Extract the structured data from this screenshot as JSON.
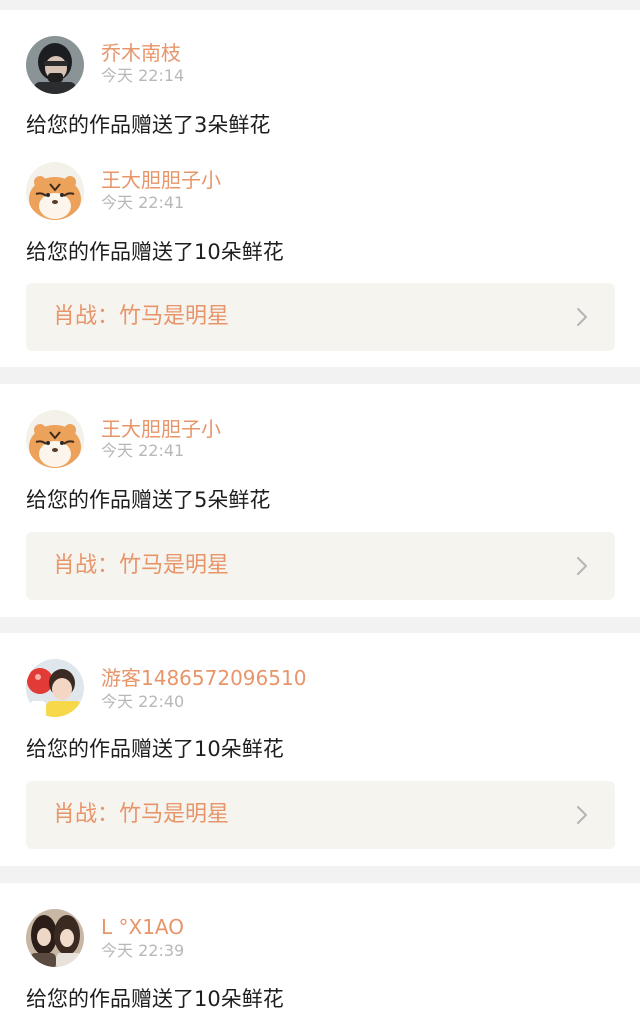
{
  "notifications": [
    {
      "user": "乔木南枝",
      "time": "今天 22:14",
      "message": "给您的作品赠送了3朵鲜花",
      "avatar": "avatar-dark-hair-photo"
    },
    {
      "user": "王大胆胆子小",
      "time": "今天 22:41",
      "message": "给您的作品赠送了10朵鲜花",
      "avatar": "avatar-tiger-illustration",
      "work_title": "肖战：竹马是明星"
    },
    {
      "user": "王大胆胆子小",
      "time": "今天 22:41",
      "message": "给您的作品赠送了5朵鲜花",
      "avatar": "avatar-tiger-illustration",
      "work_title": "肖战：竹马是明星"
    },
    {
      "user": "游客1486572096510",
      "time": "今天 22:40",
      "message": "给您的作品赠送了10朵鲜花",
      "avatar": "avatar-child-photo",
      "work_title": "肖战：竹马是明星"
    },
    {
      "user": "L °X1AO",
      "time": "今天 22:39",
      "message": "给您的作品赠送了10朵鲜花",
      "avatar": "avatar-two-people-photo"
    }
  ],
  "colors": {
    "accent": "#e8956a",
    "page_bg": "#f2f2f2",
    "link_bg": "#f5f4ef",
    "time_text": "#b8b8b8"
  }
}
